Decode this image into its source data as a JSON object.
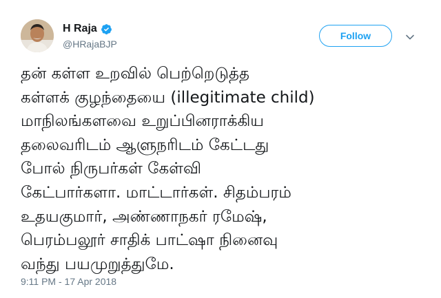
{
  "user": {
    "display_name": "H Raja",
    "handle": "@HRajaBJP",
    "verified_icon": "verified-badge-icon",
    "avatar": "avatar"
  },
  "follow_button": {
    "label": "Follow"
  },
  "menu_icon": "chevron-down-icon",
  "tweet": {
    "lines": [
      "தன் கள்ள உறவில் பெற்றெடுத்த",
      "கள்ளக் குழந்தையை (illegitimate child)",
      "மாநிலங்களவை உறுப்பினராக்கிய",
      "தலைவரிடம் ஆளுநரிடம் கேட்டது",
      "போல் நிருபர்கள் கேள்வி",
      "கேட்பார்களா. மாட்டார்கள். சிதம்பரம்",
      "உதயகுமார், அண்ணாநகர் ரமேஷ்,",
      "பெரம்பலூர் சாதிக் பாட்ஷா நினைவு",
      "வந்து பயமுறுத்துமே."
    ]
  },
  "timestamp": "9:11 PM - 17 Apr 2018",
  "colors": {
    "accent": "#1da1f2",
    "muted": "#657786",
    "text": "#14171a"
  }
}
